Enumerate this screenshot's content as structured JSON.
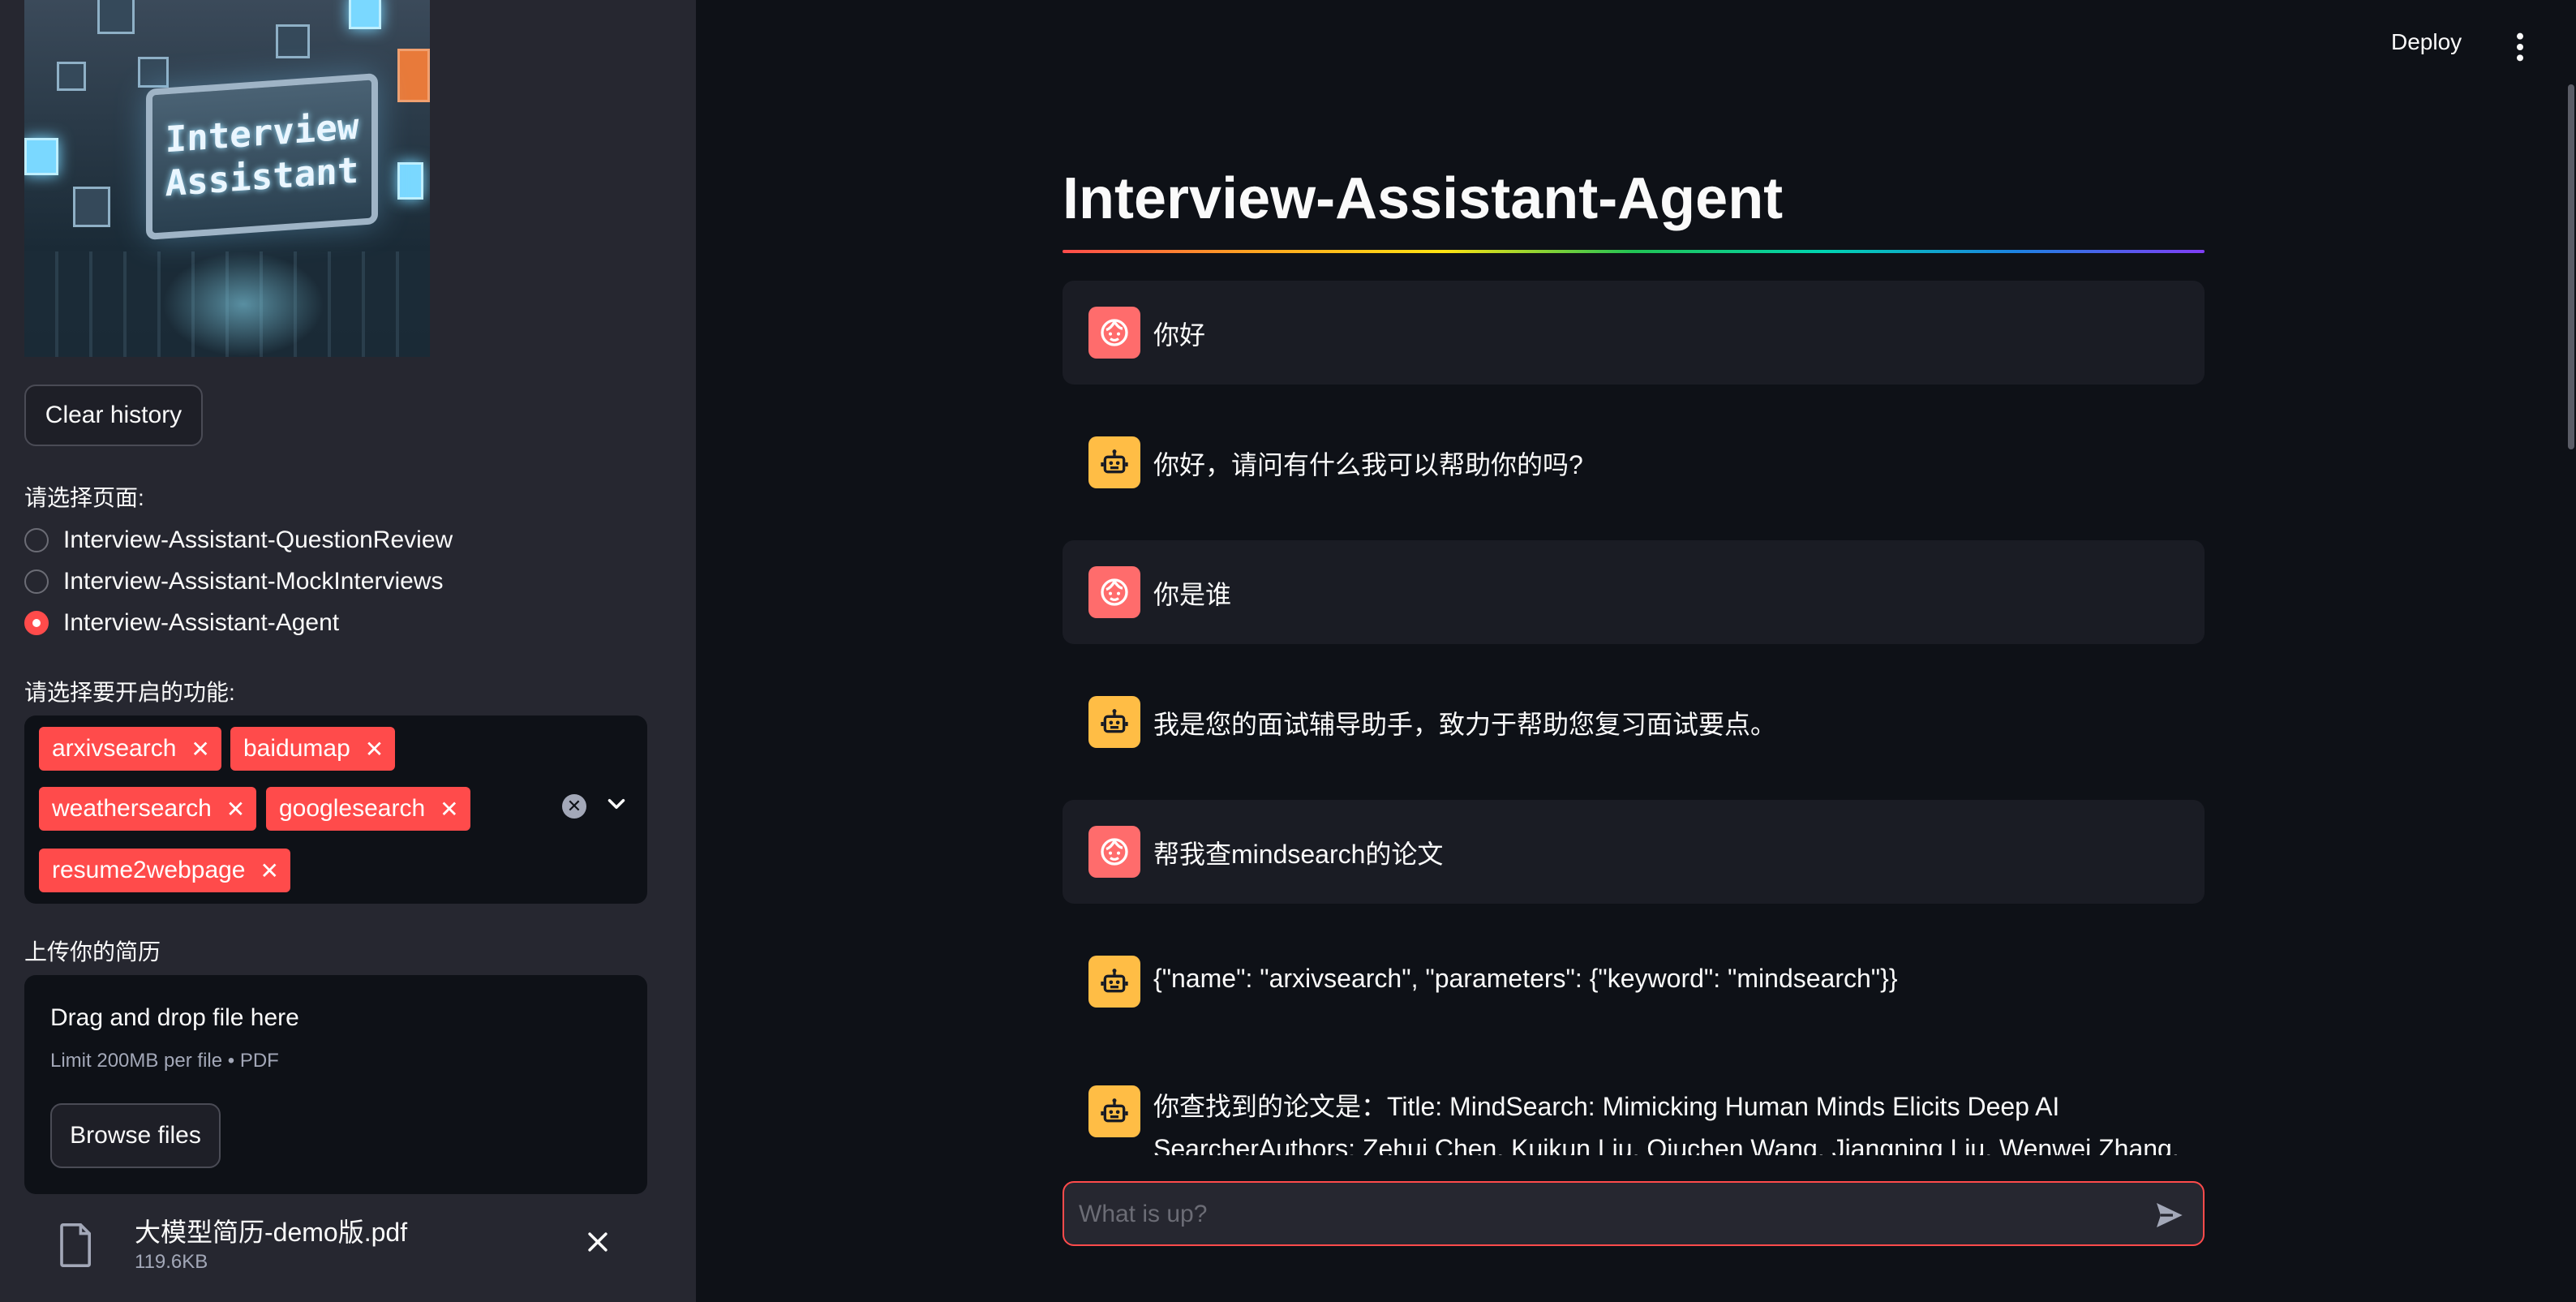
{
  "sidebar": {
    "logo_text": [
      "Interview",
      "Assistant"
    ],
    "clear_history_label": "Clear history",
    "page_select_label": "请选择页面:",
    "pages": [
      {
        "label": "Interview-Assistant-QuestionReview",
        "selected": false
      },
      {
        "label": "Interview-Assistant-MockInterviews",
        "selected": false
      },
      {
        "label": "Interview-Assistant-Agent",
        "selected": true
      }
    ],
    "features_label": "请选择要开启的功能:",
    "features": [
      "arxivsearch",
      "baidumap",
      "weathersearch",
      "googlesearch",
      "resume2webpage"
    ],
    "upload_label": "上传你的简历",
    "uploader": {
      "title": "Drag and drop file here",
      "limit": "Limit 200MB per file • PDF",
      "browse_label": "Browse files"
    },
    "uploaded_file": {
      "name": "大模型简历-demo版.pdf",
      "size": "119.6KB"
    }
  },
  "header": {
    "deploy_label": "Deploy"
  },
  "main": {
    "title": "Interview-Assistant-Agent",
    "messages": [
      {
        "role": "user",
        "text": "你好"
      },
      {
        "role": "assistant",
        "text": "你好，请问有什么我可以帮助你的吗?"
      },
      {
        "role": "user",
        "text": "你是谁"
      },
      {
        "role": "assistant",
        "text": "我是您的面试辅导助手，致力于帮助您复习面试要点。"
      },
      {
        "role": "user",
        "text": "帮我查mindsearch的论文"
      },
      {
        "role": "assistant",
        "text": "{\"name\": \"arxivsearch\", \"parameters\": {\"keyword\": \"mindsearch\"}}"
      },
      {
        "role": "assistant",
        "text": "你查找到的论文是：Title: MindSearch: Mimicking Human Minds Elicits Deep AI SearcherAuthors: Zehui Chen, Kuikun Liu, Qiuchen Wang, Jiangning Liu, Wenwei Zhang, Kai Chen, Feng"
      }
    ],
    "chat_input_placeholder": "What is up?"
  },
  "colors": {
    "accent": "#ff4b4b",
    "user_avatar": "#ff6c6c",
    "assistant_avatar": "#ffbd45",
    "sidebar_bg": "#262730",
    "main_bg": "#0e1117"
  }
}
